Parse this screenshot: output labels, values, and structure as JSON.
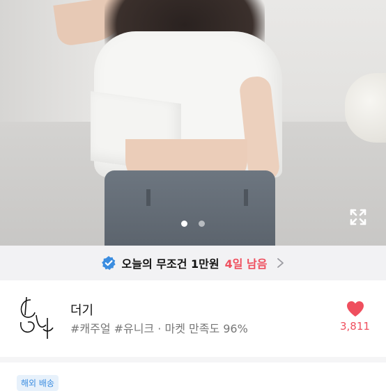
{
  "banner": {
    "label": "오늘의 무조건 1만원",
    "accent": "4일 남음",
    "accent_color": "#ef4f5e",
    "check_icon_color": "#3b8de0"
  },
  "carousel": {
    "page_count": 2,
    "current_page": 1
  },
  "shop": {
    "name": "더기",
    "tags": "#캐주얼 #유니크 · 마켓 만족도 96%",
    "like_count": "3,811",
    "heart_color": "#ef4f5e"
  },
  "badge": {
    "label": "해외 배송"
  }
}
